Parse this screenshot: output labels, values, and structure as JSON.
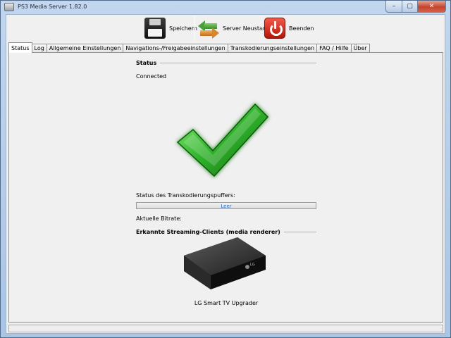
{
  "window": {
    "title": "PS3 Media Server 1.82.0"
  },
  "toolbar": {
    "save_label": "Speichern",
    "restart_label": "Server Neustart",
    "quit_label": "Beenden"
  },
  "tabs": [
    {
      "label": "Status",
      "active": true
    },
    {
      "label": "Log"
    },
    {
      "label": "Allgemeine Einstellungen"
    },
    {
      "label": "Navigations-/Freigabeeinstellungen"
    },
    {
      "label": "Transkodierungseinstellungen"
    },
    {
      "label": "FAQ / Hilfe"
    },
    {
      "label": "Über"
    }
  ],
  "status": {
    "section_title": "Status",
    "connection": "Connected",
    "buffer_label": "Status des Transkodierungspuffers:",
    "buffer_value": "Leer",
    "bitrate_label": "Aktuelle Bitrate:",
    "clients_title": "Erkannte Streaming-Clients (media renderer)",
    "client_name": "LG Smart TV Upgrader",
    "device_brand": "LG"
  },
  "colors": {
    "check_green": "#2fb12a",
    "progress_text": "#2a6cc4",
    "close_red": "#c4442b"
  },
  "icons": {
    "save": "floppy-disk-icon",
    "restart": "restart-arrows-icon",
    "quit": "power-icon",
    "status": "checkmark-icon"
  }
}
